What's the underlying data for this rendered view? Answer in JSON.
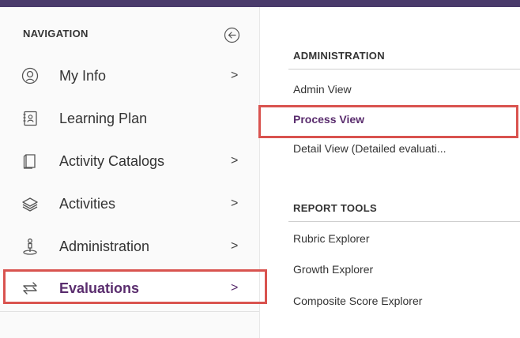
{
  "navigation": {
    "header": "NAVIGATION",
    "items": [
      {
        "label": "My Info",
        "icon": "user-circle-icon",
        "has_children": true,
        "chevron": ">"
      },
      {
        "label": "Learning Plan",
        "icon": "learning-plan-icon",
        "has_children": false,
        "chevron": ""
      },
      {
        "label": "Activity Catalogs",
        "icon": "catalog-icon",
        "has_children": true,
        "chevron": ">"
      },
      {
        "label": "Activities",
        "icon": "layers-icon",
        "has_children": true,
        "chevron": ">"
      },
      {
        "label": "Administration",
        "icon": "admin-icon",
        "has_children": true,
        "chevron": ">"
      },
      {
        "label": "Evaluations",
        "icon": "arrows-exchange-icon",
        "has_children": true,
        "chevron": ">",
        "active": true
      }
    ]
  },
  "submenu": {
    "sections": [
      {
        "header": "ADMINISTRATION",
        "items": [
          {
            "label": "Admin View"
          },
          {
            "label": "Process View",
            "active": true
          },
          {
            "label": "Detail View (Detailed evaluati..."
          }
        ]
      },
      {
        "header": "REPORT TOOLS",
        "items": [
          {
            "label": "Rubric Explorer"
          },
          {
            "label": "Growth Explorer"
          },
          {
            "label": "Composite Score Explorer"
          }
        ]
      }
    ]
  },
  "colors": {
    "topbar": "#4a3b6b",
    "accent": "#5a2d6e",
    "highlight": "#d9534f"
  }
}
